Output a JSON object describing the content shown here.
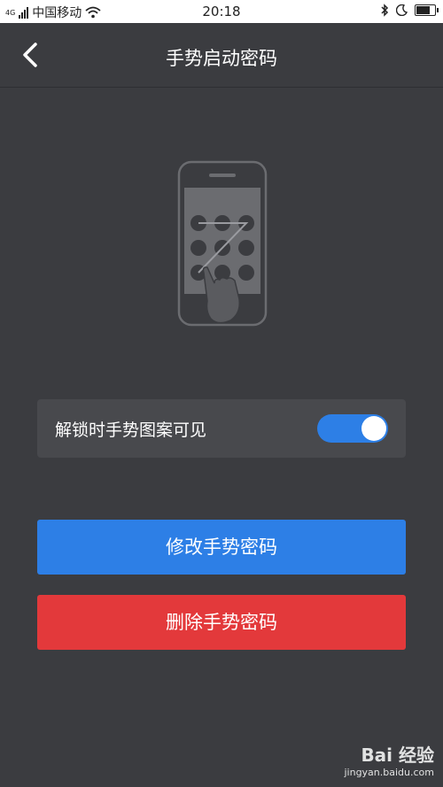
{
  "status_bar": {
    "carrier": "中国移动",
    "time": "20:18",
    "network_small": "4G"
  },
  "header": {
    "title": "手势启动密码",
    "back_icon": "chevron-left-icon"
  },
  "toggle_row": {
    "label": "解锁时手势图案可见",
    "enabled": true
  },
  "buttons": {
    "modify_label": "修改手势密码",
    "delete_label": "删除手势密码"
  },
  "watermark": {
    "brand": "Bai 经验",
    "url": "jingyan.baidu.com"
  },
  "colors": {
    "background": "#3b3c40",
    "card": "#48494d",
    "accent_blue": "#2d7fe6",
    "danger_red": "#e3393b",
    "illustration": "#6b6c70"
  }
}
